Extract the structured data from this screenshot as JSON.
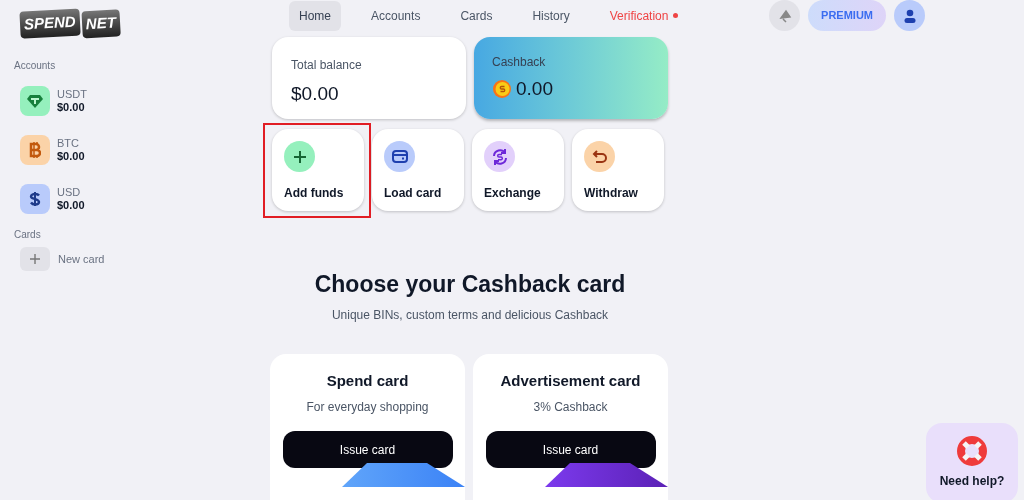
{
  "logo": {
    "left": "SPEND",
    "right": "NET"
  },
  "nav": [
    {
      "label": "Home",
      "selected": true,
      "kind": "link"
    },
    {
      "label": "Accounts",
      "selected": false,
      "kind": "link"
    },
    {
      "label": "Cards",
      "selected": false,
      "kind": "link"
    },
    {
      "label": "History",
      "selected": false,
      "kind": "link"
    },
    {
      "label": "Verification",
      "selected": false,
      "kind": "alert"
    }
  ],
  "premium": "PREMIUM",
  "sidebar": {
    "accounts_title": "Accounts",
    "accounts": [
      {
        "kind": "usdt",
        "name": "USDT",
        "amount": "$0.00"
      },
      {
        "kind": "btc",
        "name": "BTC",
        "amount": "$0.00"
      },
      {
        "kind": "usd",
        "name": "USD",
        "amount": "$0.00"
      }
    ],
    "cards_title": "Cards",
    "new_card": "New card"
  },
  "balance": {
    "label": "Total balance",
    "value": "$0.00"
  },
  "cashback": {
    "label": "Cashback",
    "value": "0.00"
  },
  "actions": [
    {
      "kind": "add",
      "label": "Add funds",
      "highlighted": true
    },
    {
      "kind": "load",
      "label": "Load card",
      "highlighted": false
    },
    {
      "kind": "exchange",
      "label": "Exchange",
      "highlighted": false
    },
    {
      "kind": "withdraw",
      "label": "Withdraw",
      "highlighted": false
    }
  ],
  "offer": {
    "title": "Choose your Cashback card",
    "subtitle": "Unique BINs, custom terms and delicious Cashback"
  },
  "card_offers": [
    {
      "kind": "spend",
      "title": "Spend card",
      "subtitle": "For everyday shopping",
      "button": "Issue card"
    },
    {
      "kind": "ads",
      "title": "Advertisement card",
      "subtitle": "3% Cashback",
      "button": "Issue card"
    }
  ],
  "help": "Need help?"
}
